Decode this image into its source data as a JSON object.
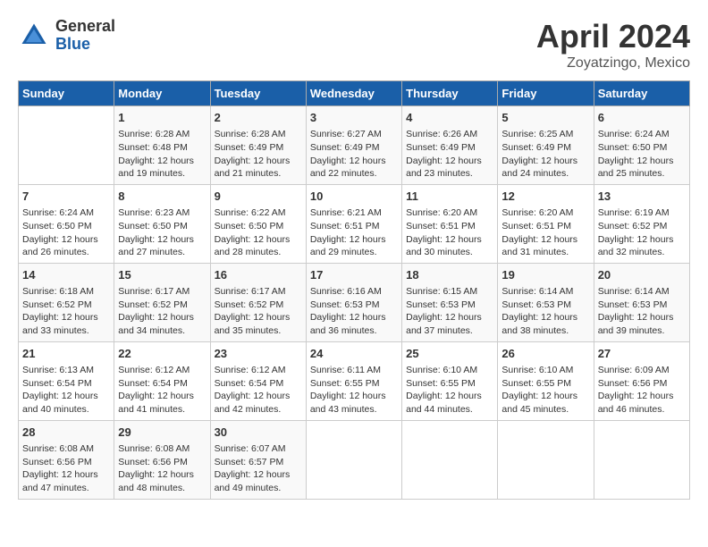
{
  "header": {
    "logo_general": "General",
    "logo_blue": "Blue",
    "month_title": "April 2024",
    "location": "Zoyatzingo, Mexico"
  },
  "days_of_week": [
    "Sunday",
    "Monday",
    "Tuesday",
    "Wednesday",
    "Thursday",
    "Friday",
    "Saturday"
  ],
  "weeks": [
    [
      {
        "day": "",
        "info": ""
      },
      {
        "day": "1",
        "info": "Sunrise: 6:28 AM\nSunset: 6:48 PM\nDaylight: 12 hours\nand 19 minutes."
      },
      {
        "day": "2",
        "info": "Sunrise: 6:28 AM\nSunset: 6:49 PM\nDaylight: 12 hours\nand 21 minutes."
      },
      {
        "day": "3",
        "info": "Sunrise: 6:27 AM\nSunset: 6:49 PM\nDaylight: 12 hours\nand 22 minutes."
      },
      {
        "day": "4",
        "info": "Sunrise: 6:26 AM\nSunset: 6:49 PM\nDaylight: 12 hours\nand 23 minutes."
      },
      {
        "day": "5",
        "info": "Sunrise: 6:25 AM\nSunset: 6:49 PM\nDaylight: 12 hours\nand 24 minutes."
      },
      {
        "day": "6",
        "info": "Sunrise: 6:24 AM\nSunset: 6:50 PM\nDaylight: 12 hours\nand 25 minutes."
      }
    ],
    [
      {
        "day": "7",
        "info": "Sunrise: 6:24 AM\nSunset: 6:50 PM\nDaylight: 12 hours\nand 26 minutes."
      },
      {
        "day": "8",
        "info": "Sunrise: 6:23 AM\nSunset: 6:50 PM\nDaylight: 12 hours\nand 27 minutes."
      },
      {
        "day": "9",
        "info": "Sunrise: 6:22 AM\nSunset: 6:50 PM\nDaylight: 12 hours\nand 28 minutes."
      },
      {
        "day": "10",
        "info": "Sunrise: 6:21 AM\nSunset: 6:51 PM\nDaylight: 12 hours\nand 29 minutes."
      },
      {
        "day": "11",
        "info": "Sunrise: 6:20 AM\nSunset: 6:51 PM\nDaylight: 12 hours\nand 30 minutes."
      },
      {
        "day": "12",
        "info": "Sunrise: 6:20 AM\nSunset: 6:51 PM\nDaylight: 12 hours\nand 31 minutes."
      },
      {
        "day": "13",
        "info": "Sunrise: 6:19 AM\nSunset: 6:52 PM\nDaylight: 12 hours\nand 32 minutes."
      }
    ],
    [
      {
        "day": "14",
        "info": "Sunrise: 6:18 AM\nSunset: 6:52 PM\nDaylight: 12 hours\nand 33 minutes."
      },
      {
        "day": "15",
        "info": "Sunrise: 6:17 AM\nSunset: 6:52 PM\nDaylight: 12 hours\nand 34 minutes."
      },
      {
        "day": "16",
        "info": "Sunrise: 6:17 AM\nSunset: 6:52 PM\nDaylight: 12 hours\nand 35 minutes."
      },
      {
        "day": "17",
        "info": "Sunrise: 6:16 AM\nSunset: 6:53 PM\nDaylight: 12 hours\nand 36 minutes."
      },
      {
        "day": "18",
        "info": "Sunrise: 6:15 AM\nSunset: 6:53 PM\nDaylight: 12 hours\nand 37 minutes."
      },
      {
        "day": "19",
        "info": "Sunrise: 6:14 AM\nSunset: 6:53 PM\nDaylight: 12 hours\nand 38 minutes."
      },
      {
        "day": "20",
        "info": "Sunrise: 6:14 AM\nSunset: 6:53 PM\nDaylight: 12 hours\nand 39 minutes."
      }
    ],
    [
      {
        "day": "21",
        "info": "Sunrise: 6:13 AM\nSunset: 6:54 PM\nDaylight: 12 hours\nand 40 minutes."
      },
      {
        "day": "22",
        "info": "Sunrise: 6:12 AM\nSunset: 6:54 PM\nDaylight: 12 hours\nand 41 minutes."
      },
      {
        "day": "23",
        "info": "Sunrise: 6:12 AM\nSunset: 6:54 PM\nDaylight: 12 hours\nand 42 minutes."
      },
      {
        "day": "24",
        "info": "Sunrise: 6:11 AM\nSunset: 6:55 PM\nDaylight: 12 hours\nand 43 minutes."
      },
      {
        "day": "25",
        "info": "Sunrise: 6:10 AM\nSunset: 6:55 PM\nDaylight: 12 hours\nand 44 minutes."
      },
      {
        "day": "26",
        "info": "Sunrise: 6:10 AM\nSunset: 6:55 PM\nDaylight: 12 hours\nand 45 minutes."
      },
      {
        "day": "27",
        "info": "Sunrise: 6:09 AM\nSunset: 6:56 PM\nDaylight: 12 hours\nand 46 minutes."
      }
    ],
    [
      {
        "day": "28",
        "info": "Sunrise: 6:08 AM\nSunset: 6:56 PM\nDaylight: 12 hours\nand 47 minutes."
      },
      {
        "day": "29",
        "info": "Sunrise: 6:08 AM\nSunset: 6:56 PM\nDaylight: 12 hours\nand 48 minutes."
      },
      {
        "day": "30",
        "info": "Sunrise: 6:07 AM\nSunset: 6:57 PM\nDaylight: 12 hours\nand 49 minutes."
      },
      {
        "day": "",
        "info": ""
      },
      {
        "day": "",
        "info": ""
      },
      {
        "day": "",
        "info": ""
      },
      {
        "day": "",
        "info": ""
      }
    ]
  ]
}
